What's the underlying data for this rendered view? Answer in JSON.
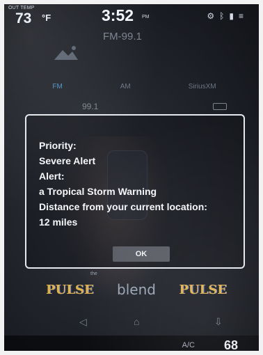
{
  "status_bar": {
    "out_temp_label": "OUT TEMP",
    "out_temp_value": "73",
    "out_temp_unit": "°F",
    "clock": "3:52",
    "clock_ampm": "PM"
  },
  "radio": {
    "station_name": "FM-99.1",
    "tabs": [
      {
        "label": "FM",
        "active": true
      },
      {
        "label": "AM",
        "active": false
      },
      {
        "label": "SiriusXM",
        "active": false
      }
    ],
    "frequency": "99.1"
  },
  "alert_dialog": {
    "lines": [
      "Priority:",
      "Severe Alert",
      "Alert:",
      "a Tropical Storm Warning",
      "Distance from your current location:",
      "12 miles"
    ],
    "ok_label": "OK"
  },
  "presets": {
    "logo_1": "PULSE",
    "logo_2_top": "the",
    "logo_2": "blend",
    "logo_3": "PULSE"
  },
  "bottom": {
    "af_label": "A/C",
    "value": "68"
  },
  "colors": {
    "accent_active_tab": "#4a90c8",
    "dialog_border": "#e6e9ee",
    "ok_button_bg": "#5b5e66"
  }
}
